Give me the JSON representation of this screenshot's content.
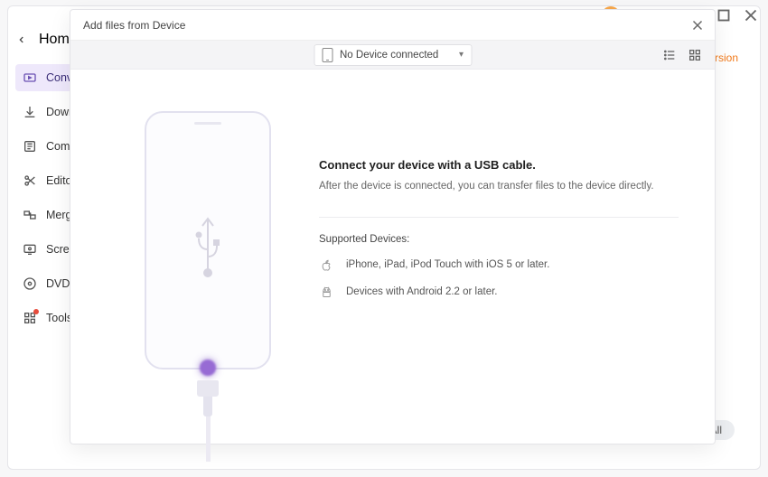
{
  "window": {
    "top_icons": {
      "avatar": true
    }
  },
  "header": {
    "home": "Home"
  },
  "sidebar": {
    "items": [
      {
        "label": "Converter"
      },
      {
        "label": "Downloader"
      },
      {
        "label": "Compressor"
      },
      {
        "label": "Editor"
      },
      {
        "label": "Merger"
      },
      {
        "label": "Screen Recorder"
      },
      {
        "label": "DVD Burner"
      },
      {
        "label": "Tools"
      }
    ]
  },
  "peek": {
    "highspeed": "nversion"
  },
  "bottom": {
    "all": "All"
  },
  "modal": {
    "title": "Add files from Device",
    "device_select": "No Device connected",
    "right": {
      "title": "Connect your device with a USB cable.",
      "subtitle": "After the device is connected, you can transfer files to the device directly.",
      "supported_label": "Supported Devices:",
      "ios": "iPhone, iPad, iPod Touch with iOS 5 or later.",
      "android": "Devices with Android 2.2 or later."
    }
  }
}
